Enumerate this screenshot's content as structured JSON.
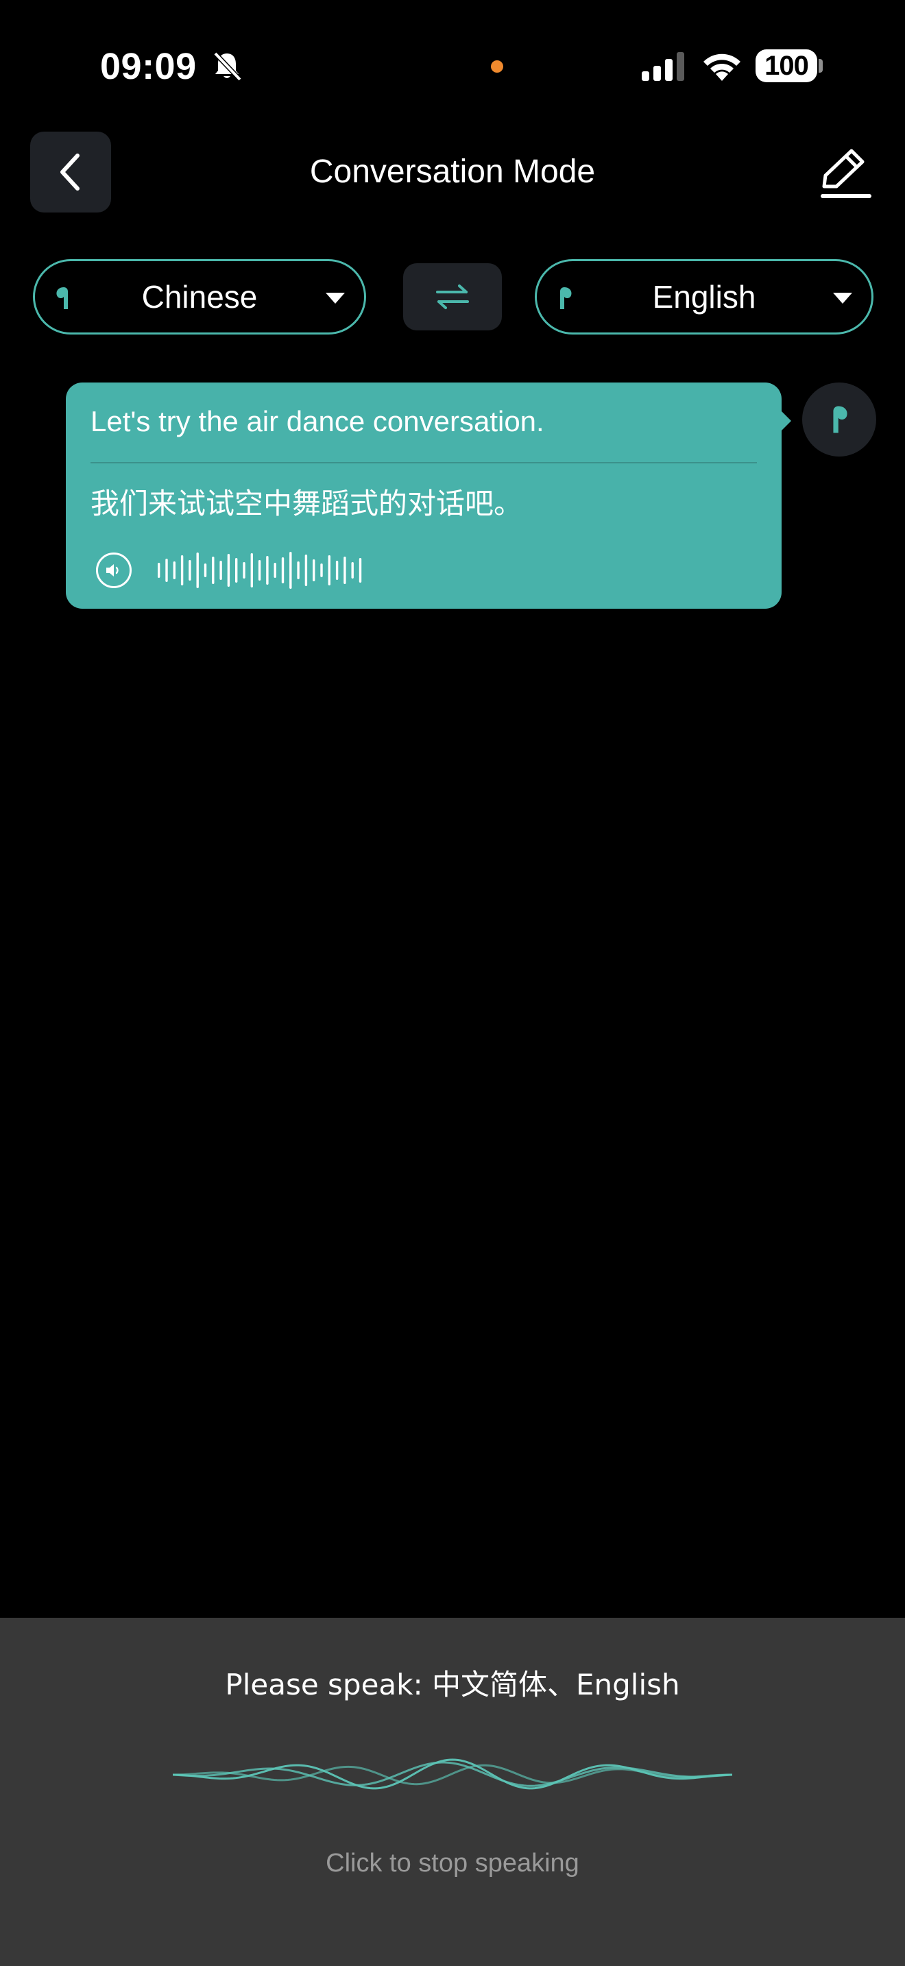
{
  "status_bar": {
    "time": "09:09",
    "battery": "100",
    "mute_icon": "bell-slash-icon",
    "recording_dot_color": "#f08a2e"
  },
  "header": {
    "title": "Conversation Mode",
    "back_icon": "chevron-left-icon",
    "edit_icon": "pencil-icon"
  },
  "languages": {
    "left": {
      "label": "Chinese",
      "icon": "earbud-left-icon"
    },
    "right": {
      "label": "English",
      "icon": "earbud-right-icon"
    },
    "swap_icon": "swap-arrows-icon",
    "accent_color": "#4bb8ac"
  },
  "messages": [
    {
      "source": "Let's try the air dance conversation.",
      "translation": "我们来试试空中舞蹈式的对话吧。",
      "bubble_color": "#48b2aa",
      "speaker_icon": "speaker-icon",
      "avatar_icon": "earbud-right-icon"
    }
  ],
  "bottom_panel": {
    "prompt": "Please speak: 中文简体、English",
    "stop_hint": "Click to stop speaking",
    "background_color": "#383838"
  }
}
